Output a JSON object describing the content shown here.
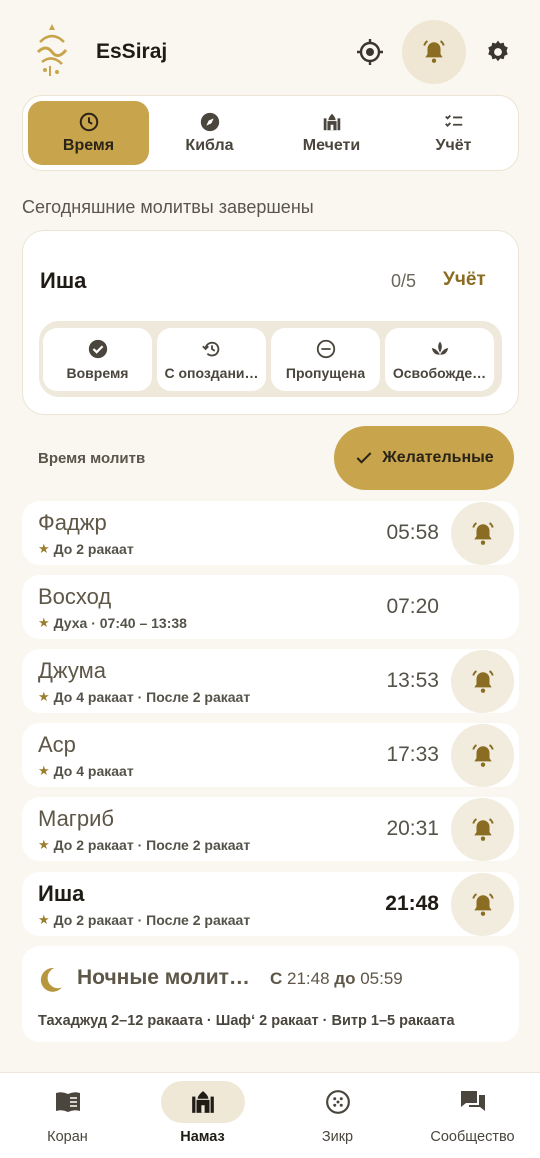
{
  "header": {
    "app_title": "EsSiraj",
    "icons": [
      "location-icon",
      "bell-icon",
      "gear-icon"
    ],
    "accent_color": "#c8a54c"
  },
  "tabs": [
    {
      "label": "Время",
      "icon": "clock-icon",
      "active": true
    },
    {
      "label": "Кибла",
      "icon": "compass-icon",
      "active": false
    },
    {
      "label": "Мечети",
      "icon": "mosque-icon",
      "active": false
    },
    {
      "label": "Учёт",
      "icon": "checklist-icon",
      "active": false
    }
  ],
  "status_title": "Сегодняшние молитвы завершены",
  "current_prayer_card": {
    "name": "Иша",
    "count": "0/5",
    "track_label": "Учёт",
    "options": [
      {
        "label": "Вовремя",
        "icon": "check-circle-icon"
      },
      {
        "label": "С опоздани…",
        "icon": "history-icon"
      },
      {
        "label": "Пропущена",
        "icon": "minus-circle-icon"
      },
      {
        "label": "Освобожде…",
        "icon": "lotus-icon"
      }
    ]
  },
  "times_label": "Время молитв",
  "preferred_button": "Желательные",
  "prayers": [
    {
      "name": "Фаджр",
      "sub": "До 2 ракаат",
      "time": "05:58",
      "bell": true,
      "current": false
    },
    {
      "name": "Восход",
      "sub": "Духа · 07:40 – 13:38",
      "time": "07:20",
      "bell": false,
      "current": false
    },
    {
      "name": "Джума",
      "sub": "До 4 ракаат · После 2 ракаат",
      "time": "13:53",
      "bell": true,
      "current": false
    },
    {
      "name": "Аср",
      "sub": "До 4 ракаат",
      "time": "17:33",
      "bell": true,
      "current": false
    },
    {
      "name": "Магриб",
      "sub": "До 2 ракаат · После 2 ракаат",
      "time": "20:31",
      "bell": true,
      "current": false
    },
    {
      "name": "Иша",
      "sub": "До 2 ракаат · После 2 ракаат",
      "time": "21:48",
      "bell": true,
      "current": true
    }
  ],
  "night": {
    "title": "Ночные молит…",
    "from_word": "С",
    "from_time": "21:48",
    "to_word": "до",
    "to_time": "05:59",
    "sub": "Тахаджуд 2–12 ракаата · Шафʻ 2 ракаат · Витр 1–5 ракаата"
  },
  "bottom_nav": [
    {
      "label": "Коран",
      "icon": "book-icon",
      "active": false
    },
    {
      "label": "Намаз",
      "icon": "mosque-icon",
      "active": true
    },
    {
      "label": "Зикр",
      "icon": "beads-icon",
      "active": false
    },
    {
      "label": "Сообщество",
      "icon": "chat-icon",
      "active": false
    }
  ]
}
